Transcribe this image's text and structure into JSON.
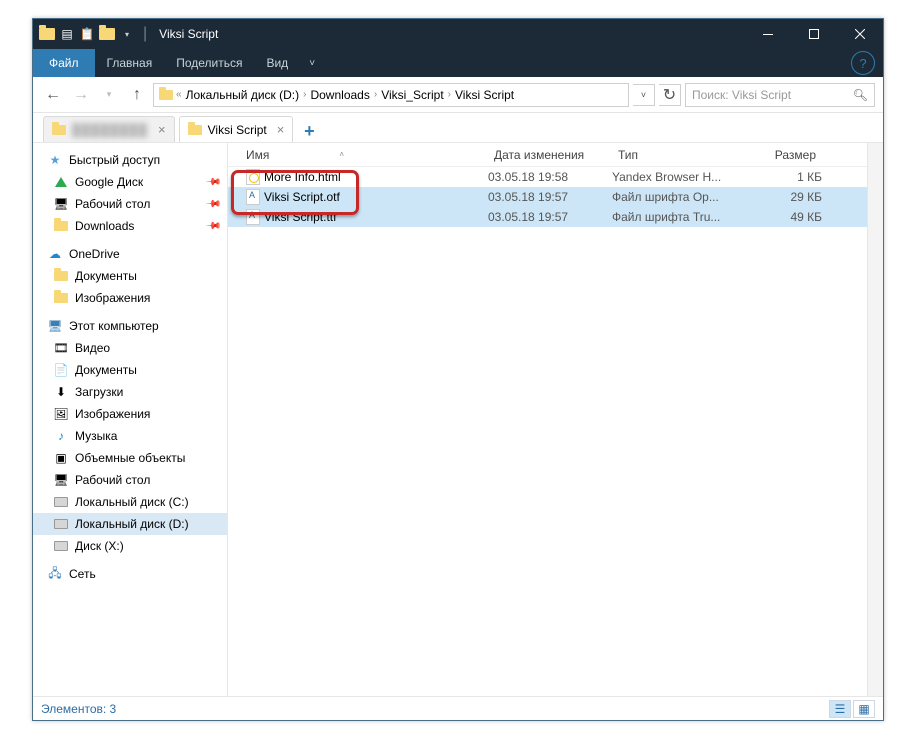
{
  "title": "Viksi Script",
  "ribbon": {
    "file": "Файл",
    "home": "Главная",
    "share": "Поделиться",
    "view": "Вид"
  },
  "breadcrumb": [
    "Локальный диск (D:)",
    "Downloads",
    "Viksi_Script",
    "Viksi Script"
  ],
  "search_placeholder": "Поиск: Viksi Script",
  "tabs": [
    {
      "label_blurred": true,
      "label": "████████"
    },
    {
      "label_blurred": false,
      "label": "Viksi Script"
    }
  ],
  "columns": {
    "name": "Имя",
    "date": "Дата изменения",
    "type": "Тип",
    "size": "Размер"
  },
  "files": [
    {
      "name": "More Info.html",
      "date": "03.05.18 19:58",
      "type": "Yandex Browser H...",
      "size": "1 КБ",
      "icon": "html",
      "selected": false
    },
    {
      "name": "Viksi Script.otf",
      "date": "03.05.18 19:57",
      "type": "Файл шрифта Op...",
      "size": "29 КБ",
      "icon": "font",
      "selected": true
    },
    {
      "name": "Viksi Script.ttf",
      "date": "03.05.18 19:57",
      "type": "Файл шрифта Tru...",
      "size": "49 КБ",
      "icon": "font",
      "selected": true
    }
  ],
  "sidebar": {
    "quick": {
      "head": "Быстрый доступ",
      "items": [
        "Google Диск",
        "Рабочий стол",
        "Downloads"
      ]
    },
    "onedrive": {
      "head": "OneDrive",
      "items": [
        "Документы",
        "Изображения"
      ]
    },
    "pc": {
      "head": "Этот компьютер",
      "items": [
        "Видео",
        "Документы",
        "Загрузки",
        "Изображения",
        "Музыка",
        "Объемные объекты",
        "Рабочий стол",
        "Локальный диск (C:)",
        "Локальный диск (D:)",
        "Диск (X:)"
      ]
    },
    "net": {
      "head": "Сеть"
    }
  },
  "status": "Элементов: 3"
}
